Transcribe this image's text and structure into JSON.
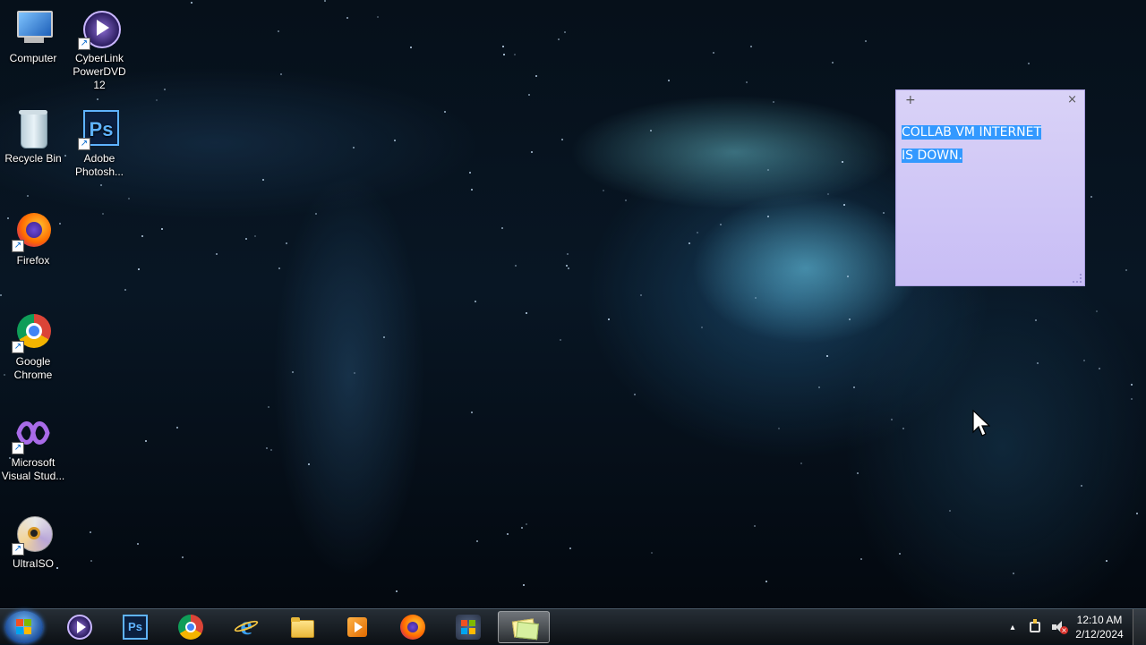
{
  "desktop_icons": [
    {
      "label_1": "Computer",
      "label_2": "",
      "icon": "computer-icon"
    },
    {
      "label_1": "CyberLink",
      "label_2": "PowerDVD 12",
      "icon": "powerdvd-icon"
    },
    {
      "label_1": "Recycle Bin",
      "label_2": "",
      "icon": "recycle-bin-icon"
    },
    {
      "label_1": "Adobe",
      "label_2": "Photosh...",
      "icon": "photoshop-icon"
    },
    {
      "label_1": "Firefox",
      "label_2": "",
      "icon": "firefox-icon"
    },
    {
      "label_1": "Google",
      "label_2": "Chrome",
      "icon": "chrome-icon"
    },
    {
      "label_1": "Microsoft",
      "label_2": "Visual Stud...",
      "icon": "visual-studio-icon"
    },
    {
      "label_1": "UltraISO",
      "label_2": "",
      "icon": "ultraiso-icon"
    }
  ],
  "sticky_note": {
    "add_glyph": "+",
    "close_glyph": "×",
    "text_line_1": "COLLAB VM INTERNET",
    "text_line_2": "IS DOWN.",
    "color": "#d2c9f6",
    "selection_color": "#3399ff"
  },
  "taskbar": {
    "pinned": [
      {
        "icon": "powerdvd-icon"
      },
      {
        "icon": "photoshop-icon",
        "glyph": "Ps"
      },
      {
        "icon": "chrome-icon"
      },
      {
        "icon": "internet-explorer-icon",
        "glyph": "e"
      },
      {
        "icon": "file-explorer-icon"
      },
      {
        "icon": "media-player-icon"
      },
      {
        "icon": "firefox-icon"
      },
      {
        "icon": "windows-icon"
      },
      {
        "icon": "sticky-notes-icon",
        "active": true
      }
    ],
    "tray": {
      "overflow_glyph": "▴",
      "power_icon": "power-icon",
      "volume_icon": "volume-muted-icon"
    },
    "clock": {
      "time": "12:10 AM",
      "date": "2/12/2024"
    }
  }
}
